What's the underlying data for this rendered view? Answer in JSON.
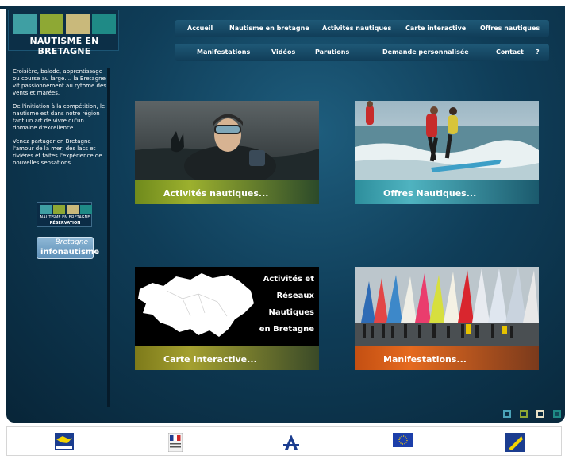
{
  "site": {
    "title": "NAUTISME EN BRETAGNE",
    "logo_colors": [
      "#3f9fa3",
      "#8ea834",
      "#c9b97b",
      "#1f8a86"
    ]
  },
  "nav_top": [
    {
      "label": "Accueil"
    },
    {
      "label": "Nautisme en bretagne"
    },
    {
      "label": "Activités nautiques"
    },
    {
      "label": "Carte interactive"
    },
    {
      "label": "Offres nautiques"
    }
  ],
  "nav_bottom": [
    {
      "label": "Manifestations"
    },
    {
      "label": "Vidéos"
    },
    {
      "label": "Parutions"
    },
    {
      "label": "Demande personnalisée"
    },
    {
      "label": "Contact"
    },
    {
      "label": "?"
    }
  ],
  "sidebar": {
    "paragraphs": [
      "Croisière, balade, apprentissage ou course au large.... la Bretagne vit passionnément au rythme des vents et marées.",
      "De l'initiation à la compétition, le nautisme est dans notre région tant un art de vivre qu'un domaine d'excellence.",
      "Venez partager en Bretagne l'amour de la mer, des lacs et rivières et faites l'expérience de nouvelles sensations."
    ],
    "badge_reservation": {
      "line1": "NAUTISME EN BRETAGNE",
      "line2": "RÉSERVATION"
    },
    "badge_info": {
      "line1": "Bretagne",
      "line2": "infonautisme"
    }
  },
  "tiles": [
    {
      "caption": "Activités nautiques...",
      "color": "green"
    },
    {
      "caption": "Offres Nautiques...",
      "color": "teal"
    },
    {
      "caption": "Carte Interactive...",
      "color": "olive",
      "map_lines": [
        "Activités et",
        "Réseaux",
        "Nautiques",
        "en Bretagne"
      ]
    },
    {
      "caption": "Manifestations...",
      "color": "orange"
    }
  ],
  "slide_dots": [
    {
      "color": "#4aa3b8"
    },
    {
      "color": "#8ea834"
    },
    {
      "color": "#e8e2c8"
    },
    {
      "color": "#1f8a86"
    }
  ],
  "footer_logos": [
    {
      "icon": "region-bretagne-logo-icon"
    },
    {
      "icon": "republique-francaise-logo-icon"
    },
    {
      "icon": "federation-a-logo-icon"
    },
    {
      "icon": "european-union-flag-icon"
    },
    {
      "icon": "partner-logo-icon"
    }
  ]
}
